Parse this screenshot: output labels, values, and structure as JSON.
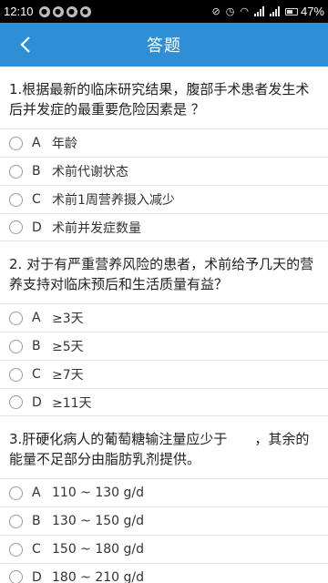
{
  "status_bar": {
    "time": "12:10",
    "battery": "47%",
    "battery_fraction": 0.47,
    "left_icons": [
      "notification-icon",
      "notification-icon",
      "notification-icon",
      "notification-icon"
    ]
  },
  "app_bar": {
    "title": "答题",
    "back_label": "‹"
  },
  "questions": [
    {
      "text": "1.根据最新的临床研究结果，腹部手术患者发生术后并发症的最重要危险因素是 ？",
      "options": [
        {
          "letter": "A",
          "text": "年龄"
        },
        {
          "letter": "B",
          "text": "术前代谢状态"
        },
        {
          "letter": "C",
          "text": "术前1周营养摄入减少"
        },
        {
          "letter": "D",
          "text": "术前并发症数量"
        }
      ]
    },
    {
      "text": "2. 对于有严重营养风险的患者，术前给予几天的营养支持对临床预后和生活质量有益？",
      "options": [
        {
          "letter": "A",
          "text": "≥3天"
        },
        {
          "letter": "B",
          "text": "≥5天"
        },
        {
          "letter": "C",
          "text": "≥7天"
        },
        {
          "letter": "D",
          "text": "≥11天"
        }
      ]
    },
    {
      "text": "3.肝硬化病人的葡萄糖输注量应少于　　，其余的能量不足部分由脂肪乳剂提供。",
      "options": [
        {
          "letter": "A",
          "text": "110 ~ 130 g/d"
        },
        {
          "letter": "B",
          "text": "130 ~ 150 g/d"
        },
        {
          "letter": "C",
          "text": "150 ~ 180 g/d"
        },
        {
          "letter": "D",
          "text": "180 ~ 210 g/d"
        }
      ]
    }
  ],
  "colors": {
    "app_bar": "#2f8fd6",
    "status_bar": "#000000",
    "divider": "#e6e6e6"
  }
}
